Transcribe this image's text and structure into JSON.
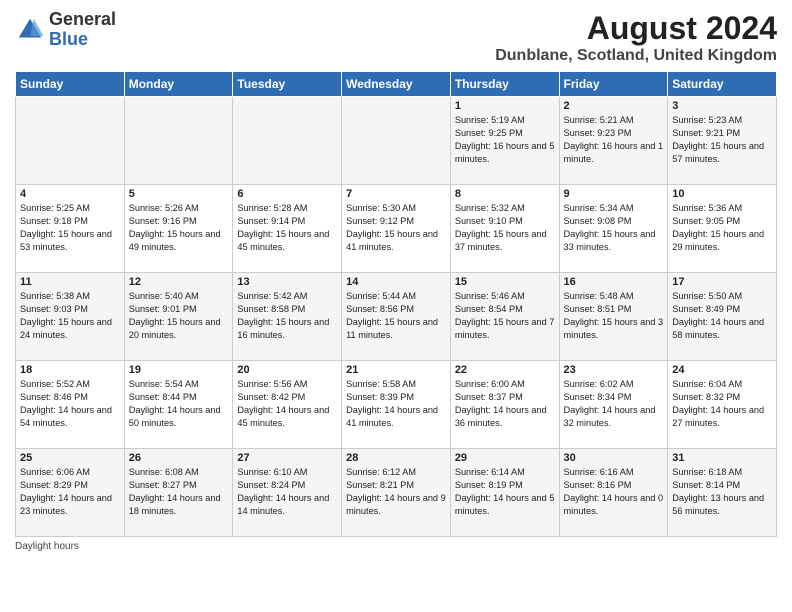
{
  "logo": {
    "general": "General",
    "blue": "Blue"
  },
  "header": {
    "title": "August 2024",
    "subtitle": "Dunblane, Scotland, United Kingdom"
  },
  "footer": {
    "text": "Daylight hours"
  },
  "columns": [
    "Sunday",
    "Monday",
    "Tuesday",
    "Wednesday",
    "Thursday",
    "Friday",
    "Saturday"
  ],
  "weeks": [
    [
      {
        "day": "",
        "sunrise": "",
        "sunset": "",
        "daylight": ""
      },
      {
        "day": "",
        "sunrise": "",
        "sunset": "",
        "daylight": ""
      },
      {
        "day": "",
        "sunrise": "",
        "sunset": "",
        "daylight": ""
      },
      {
        "day": "",
        "sunrise": "",
        "sunset": "",
        "daylight": ""
      },
      {
        "day": "1",
        "sunrise": "Sunrise: 5:19 AM",
        "sunset": "Sunset: 9:25 PM",
        "daylight": "Daylight: 16 hours and 5 minutes."
      },
      {
        "day": "2",
        "sunrise": "Sunrise: 5:21 AM",
        "sunset": "Sunset: 9:23 PM",
        "daylight": "Daylight: 16 hours and 1 minute."
      },
      {
        "day": "3",
        "sunrise": "Sunrise: 5:23 AM",
        "sunset": "Sunset: 9:21 PM",
        "daylight": "Daylight: 15 hours and 57 minutes."
      }
    ],
    [
      {
        "day": "4",
        "sunrise": "Sunrise: 5:25 AM",
        "sunset": "Sunset: 9:18 PM",
        "daylight": "Daylight: 15 hours and 53 minutes."
      },
      {
        "day": "5",
        "sunrise": "Sunrise: 5:26 AM",
        "sunset": "Sunset: 9:16 PM",
        "daylight": "Daylight: 15 hours and 49 minutes."
      },
      {
        "day": "6",
        "sunrise": "Sunrise: 5:28 AM",
        "sunset": "Sunset: 9:14 PM",
        "daylight": "Daylight: 15 hours and 45 minutes."
      },
      {
        "day": "7",
        "sunrise": "Sunrise: 5:30 AM",
        "sunset": "Sunset: 9:12 PM",
        "daylight": "Daylight: 15 hours and 41 minutes."
      },
      {
        "day": "8",
        "sunrise": "Sunrise: 5:32 AM",
        "sunset": "Sunset: 9:10 PM",
        "daylight": "Daylight: 15 hours and 37 minutes."
      },
      {
        "day": "9",
        "sunrise": "Sunrise: 5:34 AM",
        "sunset": "Sunset: 9:08 PM",
        "daylight": "Daylight: 15 hours and 33 minutes."
      },
      {
        "day": "10",
        "sunrise": "Sunrise: 5:36 AM",
        "sunset": "Sunset: 9:05 PM",
        "daylight": "Daylight: 15 hours and 29 minutes."
      }
    ],
    [
      {
        "day": "11",
        "sunrise": "Sunrise: 5:38 AM",
        "sunset": "Sunset: 9:03 PM",
        "daylight": "Daylight: 15 hours and 24 minutes."
      },
      {
        "day": "12",
        "sunrise": "Sunrise: 5:40 AM",
        "sunset": "Sunset: 9:01 PM",
        "daylight": "Daylight: 15 hours and 20 minutes."
      },
      {
        "day": "13",
        "sunrise": "Sunrise: 5:42 AM",
        "sunset": "Sunset: 8:58 PM",
        "daylight": "Daylight: 15 hours and 16 minutes."
      },
      {
        "day": "14",
        "sunrise": "Sunrise: 5:44 AM",
        "sunset": "Sunset: 8:56 PM",
        "daylight": "Daylight: 15 hours and 11 minutes."
      },
      {
        "day": "15",
        "sunrise": "Sunrise: 5:46 AM",
        "sunset": "Sunset: 8:54 PM",
        "daylight": "Daylight: 15 hours and 7 minutes."
      },
      {
        "day": "16",
        "sunrise": "Sunrise: 5:48 AM",
        "sunset": "Sunset: 8:51 PM",
        "daylight": "Daylight: 15 hours and 3 minutes."
      },
      {
        "day": "17",
        "sunrise": "Sunrise: 5:50 AM",
        "sunset": "Sunset: 8:49 PM",
        "daylight": "Daylight: 14 hours and 58 minutes."
      }
    ],
    [
      {
        "day": "18",
        "sunrise": "Sunrise: 5:52 AM",
        "sunset": "Sunset: 8:46 PM",
        "daylight": "Daylight: 14 hours and 54 minutes."
      },
      {
        "day": "19",
        "sunrise": "Sunrise: 5:54 AM",
        "sunset": "Sunset: 8:44 PM",
        "daylight": "Daylight: 14 hours and 50 minutes."
      },
      {
        "day": "20",
        "sunrise": "Sunrise: 5:56 AM",
        "sunset": "Sunset: 8:42 PM",
        "daylight": "Daylight: 14 hours and 45 minutes."
      },
      {
        "day": "21",
        "sunrise": "Sunrise: 5:58 AM",
        "sunset": "Sunset: 8:39 PM",
        "daylight": "Daylight: 14 hours and 41 minutes."
      },
      {
        "day": "22",
        "sunrise": "Sunrise: 6:00 AM",
        "sunset": "Sunset: 8:37 PM",
        "daylight": "Daylight: 14 hours and 36 minutes."
      },
      {
        "day": "23",
        "sunrise": "Sunrise: 6:02 AM",
        "sunset": "Sunset: 8:34 PM",
        "daylight": "Daylight: 14 hours and 32 minutes."
      },
      {
        "day": "24",
        "sunrise": "Sunrise: 6:04 AM",
        "sunset": "Sunset: 8:32 PM",
        "daylight": "Daylight: 14 hours and 27 minutes."
      }
    ],
    [
      {
        "day": "25",
        "sunrise": "Sunrise: 6:06 AM",
        "sunset": "Sunset: 8:29 PM",
        "daylight": "Daylight: 14 hours and 23 minutes."
      },
      {
        "day": "26",
        "sunrise": "Sunrise: 6:08 AM",
        "sunset": "Sunset: 8:27 PM",
        "daylight": "Daylight: 14 hours and 18 minutes."
      },
      {
        "day": "27",
        "sunrise": "Sunrise: 6:10 AM",
        "sunset": "Sunset: 8:24 PM",
        "daylight": "Daylight: 14 hours and 14 minutes."
      },
      {
        "day": "28",
        "sunrise": "Sunrise: 6:12 AM",
        "sunset": "Sunset: 8:21 PM",
        "daylight": "Daylight: 14 hours and 9 minutes."
      },
      {
        "day": "29",
        "sunrise": "Sunrise: 6:14 AM",
        "sunset": "Sunset: 8:19 PM",
        "daylight": "Daylight: 14 hours and 5 minutes."
      },
      {
        "day": "30",
        "sunrise": "Sunrise: 6:16 AM",
        "sunset": "Sunset: 8:16 PM",
        "daylight": "Daylight: 14 hours and 0 minutes."
      },
      {
        "day": "31",
        "sunrise": "Sunrise: 6:18 AM",
        "sunset": "Sunset: 8:14 PM",
        "daylight": "Daylight: 13 hours and 56 minutes."
      }
    ]
  ]
}
